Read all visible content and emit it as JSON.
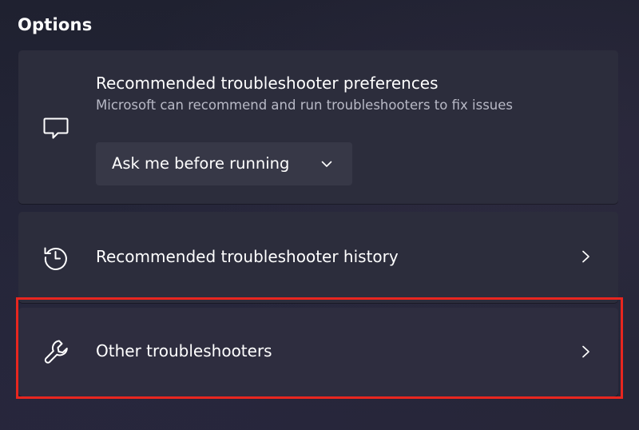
{
  "section": {
    "title": "Options"
  },
  "preferences": {
    "icon": "message-icon",
    "title": "Recommended troubleshooter preferences",
    "description": "Microsoft can recommend and run troubleshooters to fix issues",
    "dropdown": {
      "selected": "Ask me before running",
      "icon": "chevron-down-icon"
    }
  },
  "history": {
    "icon": "history-icon",
    "label": "Recommended troubleshooter history",
    "chevron": "chevron-right-icon"
  },
  "other": {
    "icon": "wrench-icon",
    "label": "Other troubleshooters",
    "chevron": "chevron-right-icon"
  },
  "colors": {
    "background": "#20222f",
    "card": "#2c2d3c",
    "dropdown": "#373847",
    "highlight": "#e8261f",
    "secondary_text": "#b8b9c6"
  }
}
